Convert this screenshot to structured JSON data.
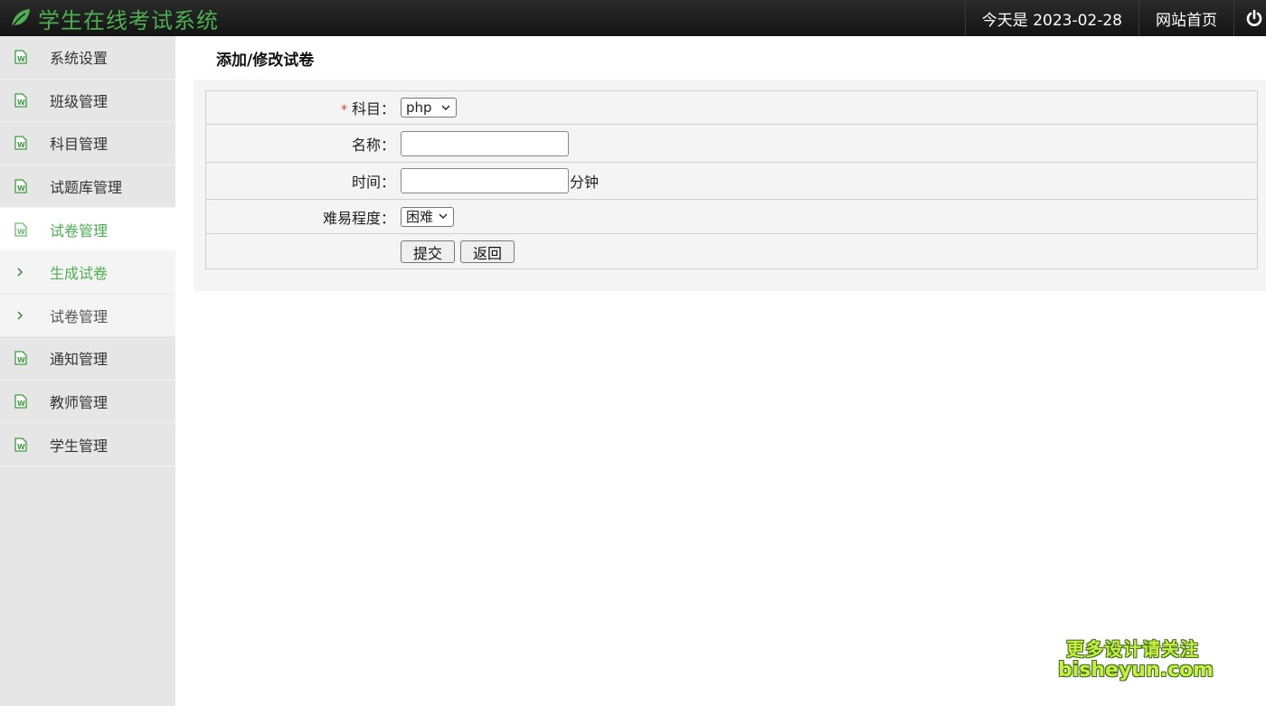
{
  "header": {
    "title": "学生在线考试系统",
    "date_text": "今天是 2023-02-28",
    "home_label": "网站首页"
  },
  "sidebar": {
    "items": [
      {
        "label": "系统设置"
      },
      {
        "label": "班级管理"
      },
      {
        "label": "科目管理"
      },
      {
        "label": "试题库管理"
      },
      {
        "label": "试卷管理"
      },
      {
        "label": "通知管理"
      },
      {
        "label": "教师管理"
      },
      {
        "label": "学生管理"
      }
    ],
    "subitems": [
      {
        "label": "生成试卷"
      },
      {
        "label": "试卷管理"
      }
    ]
  },
  "main": {
    "page_title": "添加/修改试卷",
    "form": {
      "required_mark": "*",
      "subject_label": "科目：",
      "subject_value": "php",
      "name_label": "名称：",
      "name_value": "",
      "time_label": "时间：",
      "time_value": "",
      "time_unit": "分钟",
      "difficulty_label": "难易程度：",
      "difficulty_value": "困难",
      "submit_label": "提交",
      "back_label": "返回"
    }
  },
  "watermark": {
    "line1": "更多设计请关注",
    "line2": "bisheyun.com"
  },
  "colors": {
    "accent": "#4caf50",
    "header_bg": "#1e1e1e",
    "sidebar_bg": "#e6e6e6",
    "required": "#e53935"
  }
}
